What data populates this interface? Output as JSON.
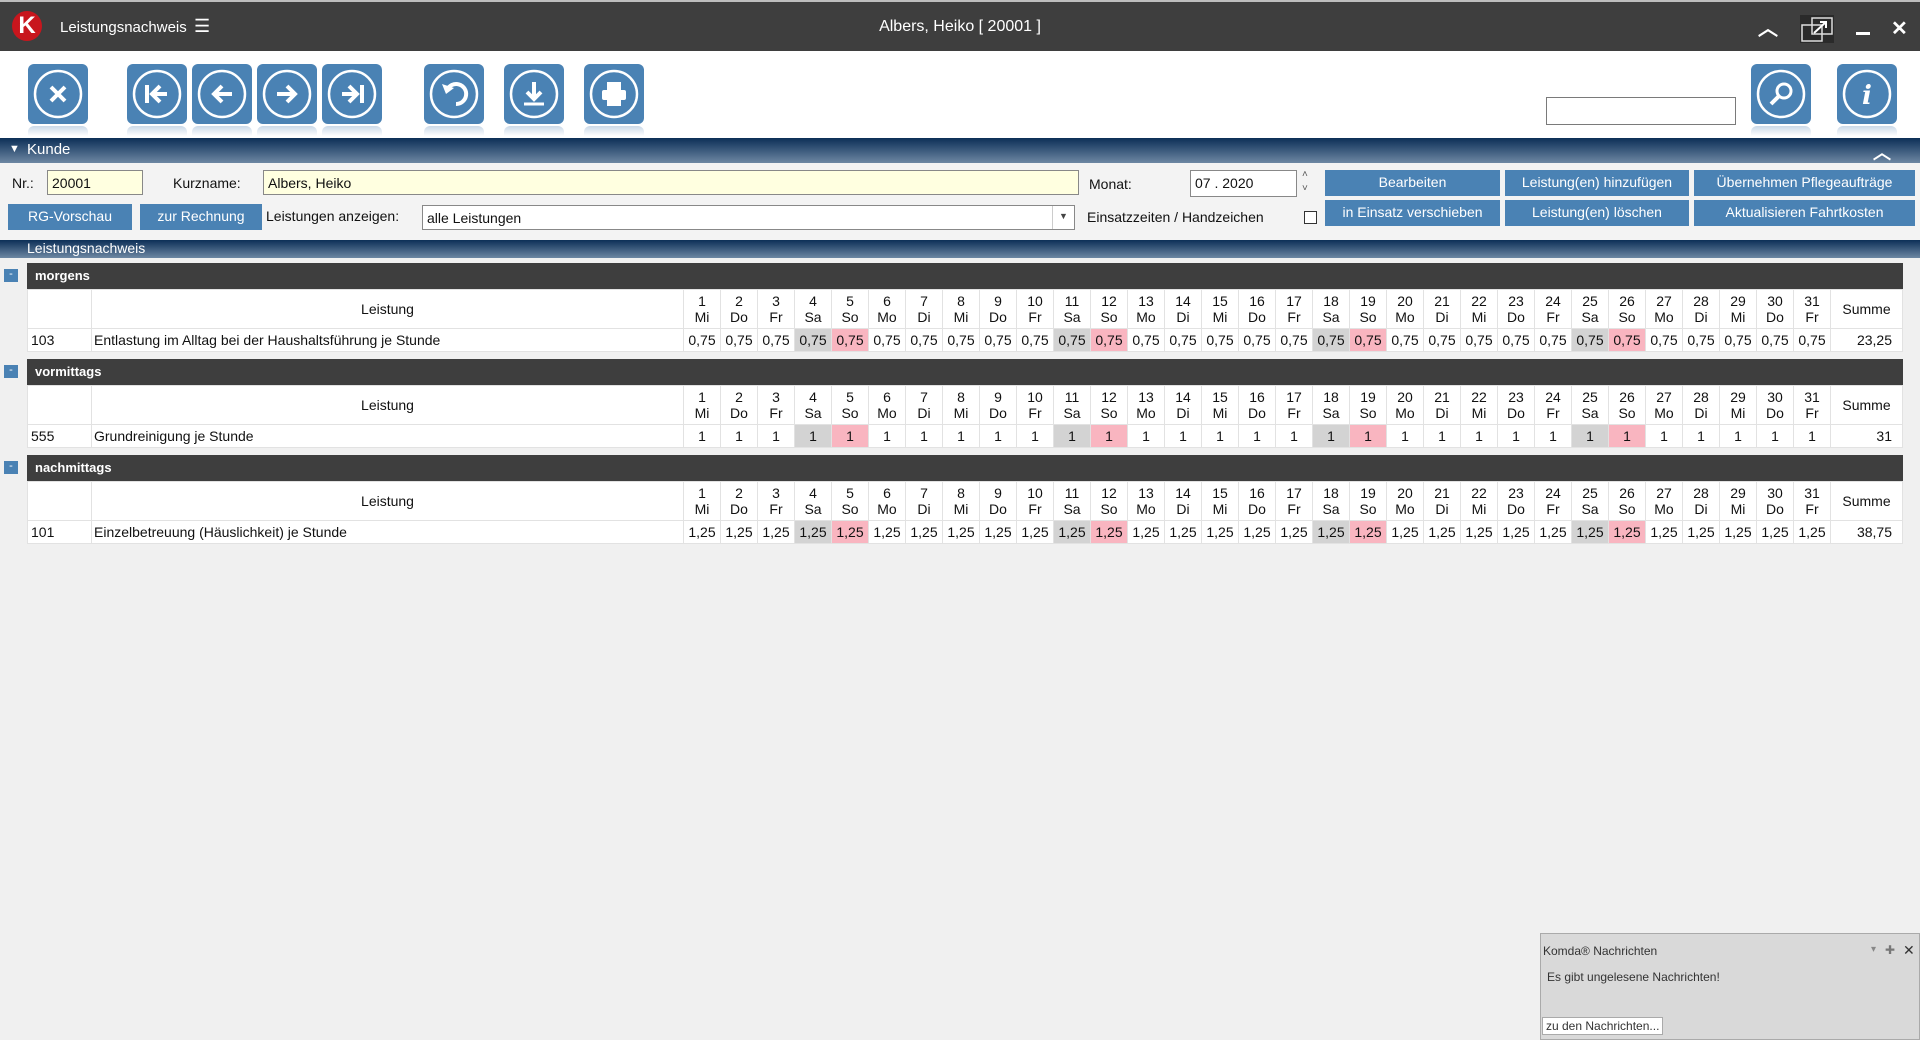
{
  "titlebar": {
    "logo": "K",
    "app_title": "Leistungsnachweis",
    "window_title": "Albers, Heiko  [ 20001 ]"
  },
  "toolbar": {
    "buttons": [
      "close-icon",
      "first-icon",
      "previous-icon",
      "next-icon",
      "last-icon",
      "undo-icon",
      "download-icon",
      "print-icon",
      "search-icon",
      "info-icon"
    ],
    "search_value": ""
  },
  "kunde": {
    "section_title": "Kunde",
    "nr_label": "Nr.:",
    "nr_value": "20001",
    "kurzname_label": "Kurzname:",
    "kurzname_value": "Albers, Heiko",
    "monat_label": "Monat:",
    "monat_value": "07 . 2020",
    "leistungen_label": "Leistungen anzeigen:",
    "leistungen_value": "alle Leistungen",
    "einsatz_label": "Einsatzzeiten / Handzeichen",
    "einsatz_checked": false,
    "buttons": {
      "rg_vorschau": "RG-Vorschau",
      "zur_rechnung": "zur Rechnung",
      "bearbeiten": "Bearbeiten",
      "hinzufuegen": "Leistung(en) hinzufügen",
      "uebernehmen": "Übernehmen Pflegeaufträge",
      "verschieben": "in Einsatz verschieben",
      "loeschen": "Leistung(en) löschen",
      "fahrtkosten": "Aktualisieren Fahrtkosten"
    }
  },
  "nachweis": {
    "section_title": "Leistungsnachweis",
    "col_leistung": "Leistung",
    "col_summe": "Summe",
    "days": [
      [
        "1",
        "Mi"
      ],
      [
        "2",
        "Do"
      ],
      [
        "3",
        "Fr"
      ],
      [
        "4",
        "Sa"
      ],
      [
        "5",
        "So"
      ],
      [
        "6",
        "Mo"
      ],
      [
        "7",
        "Di"
      ],
      [
        "8",
        "Mi"
      ],
      [
        "9",
        "Do"
      ],
      [
        "10",
        "Fr"
      ],
      [
        "11",
        "Sa"
      ],
      [
        "12",
        "So"
      ],
      [
        "13",
        "Mo"
      ],
      [
        "14",
        "Di"
      ],
      [
        "15",
        "Mi"
      ],
      [
        "16",
        "Do"
      ],
      [
        "17",
        "Fr"
      ],
      [
        "18",
        "Sa"
      ],
      [
        "19",
        "So"
      ],
      [
        "20",
        "Mo"
      ],
      [
        "21",
        "Di"
      ],
      [
        "22",
        "Mi"
      ],
      [
        "23",
        "Do"
      ],
      [
        "24",
        "Fr"
      ],
      [
        "25",
        "Sa"
      ],
      [
        "26",
        "So"
      ],
      [
        "27",
        "Mo"
      ],
      [
        "28",
        "Di"
      ],
      [
        "29",
        "Mi"
      ],
      [
        "30",
        "Do"
      ],
      [
        "31",
        "Fr"
      ]
    ],
    "groups": [
      {
        "name": "morgens",
        "rows": [
          {
            "nr": "103",
            "leistung": "Entlastung im Alltag bei der Haushaltsführung je Stunde",
            "values": [
              "0,75",
              "0,75",
              "0,75",
              "0,75",
              "0,75",
              "0,75",
              "0,75",
              "0,75",
              "0,75",
              "0,75",
              "0,75",
              "0,75",
              "0,75",
              "0,75",
              "0,75",
              "0,75",
              "0,75",
              "0,75",
              "0,75",
              "0,75",
              "0,75",
              "0,75",
              "0,75",
              "0,75",
              "0,75",
              "0,75",
              "0,75",
              "0,75",
              "0,75",
              "0,75",
              "0,75"
            ],
            "summe": "23,25"
          }
        ]
      },
      {
        "name": "vormittags",
        "rows": [
          {
            "nr": "555",
            "leistung": "Grundreinigung je Stunde",
            "values": [
              "1",
              "1",
              "1",
              "1",
              "1",
              "1",
              "1",
              "1",
              "1",
              "1",
              "1",
              "1",
              "1",
              "1",
              "1",
              "1",
              "1",
              "1",
              "1",
              "1",
              "1",
              "1",
              "1",
              "1",
              "1",
              "1",
              "1",
              "1",
              "1",
              "1",
              "1"
            ],
            "summe": "31"
          }
        ]
      },
      {
        "name": "nachmittags",
        "rows": [
          {
            "nr": "101",
            "leistung": "Einzelbetreuung (Häuslichkeit) je Stunde",
            "values": [
              "1,25",
              "1,25",
              "1,25",
              "1,25",
              "1,25",
              "1,25",
              "1,25",
              "1,25",
              "1,25",
              "1,25",
              "1,25",
              "1,25",
              "1,25",
              "1,25",
              "1,25",
              "1,25",
              "1,25",
              "1,25",
              "1,25",
              "1,25",
              "1,25",
              "1,25",
              "1,25",
              "1,25",
              "1,25",
              "1,25",
              "1,25",
              "1,25",
              "1,25",
              "1,25",
              "1,25"
            ],
            "summe": "38,75"
          }
        ]
      }
    ]
  },
  "notification": {
    "title": "Komda® Nachrichten",
    "message": "Es gibt ungelesene Nachrichten!",
    "button": "zu den Nachrichten..."
  },
  "colors": {
    "accent": "#4a82b4",
    "titlebar": "#3e3e3e",
    "saturday": "#d3d3d3",
    "sunday": "#f9b5c0",
    "input_yellow": "#ffffe0"
  }
}
